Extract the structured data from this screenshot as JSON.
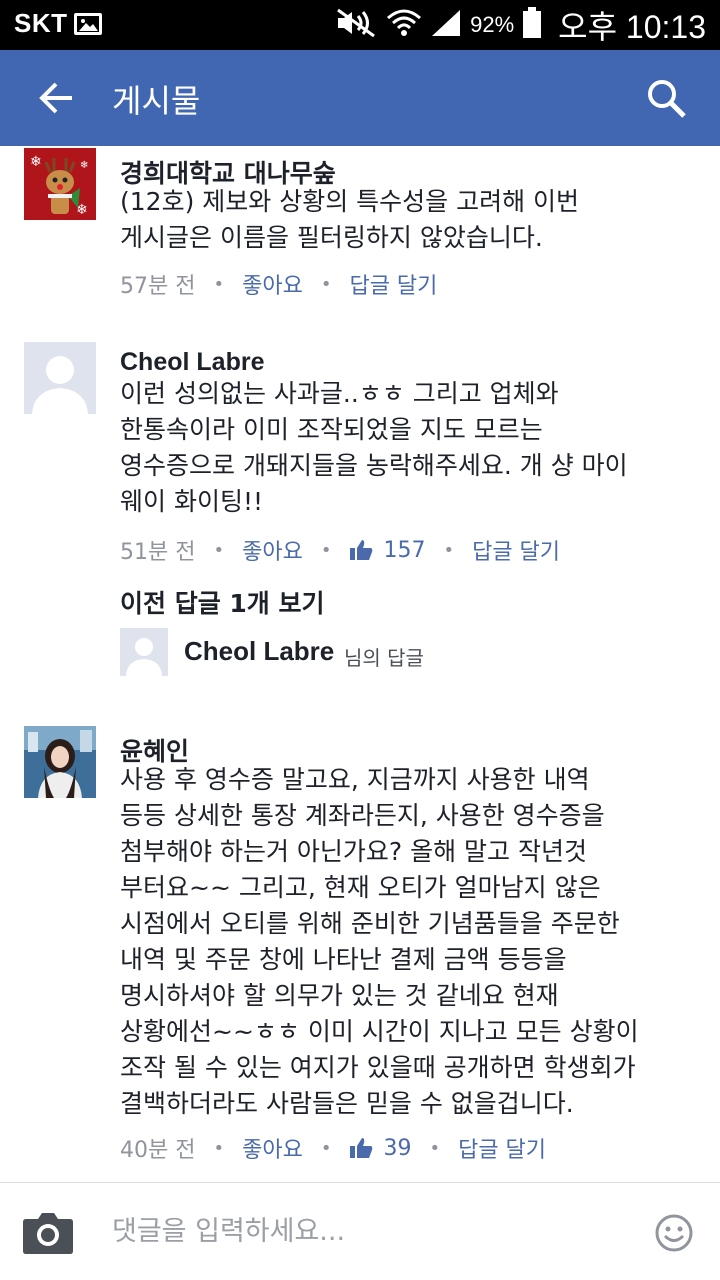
{
  "status_bar": {
    "carrier": "SKT",
    "battery": "92%",
    "time": "오후 10:13"
  },
  "app_bar": {
    "title": "게시물",
    "back_icon": "arrow-left-icon",
    "search_icon": "search-icon"
  },
  "comments": [
    {
      "author": "경희대학교 대나무숲",
      "avatar": "reindeer-avatar",
      "lines": [
        "(12호) 제보와 상황의 특수성을 고려해 이번",
        "게시글은 이름을 필터링하지 않았습니다."
      ],
      "time": "57분 전",
      "like_label": "좋아요",
      "reply_label": "답글 달기"
    },
    {
      "author": "Cheol Labre",
      "avatar": "default-profile-avatar",
      "lines": [
        "이런 성의없는 사과글..ㅎㅎ 그리고 업체와",
        "한통속이라 이미 조작되었을 지도 모르는",
        "영수증으로 개돼지들을 농락해주세요. 개 샹 마이",
        "웨이 화이팅!!"
      ],
      "time": "51분 전",
      "like_label": "좋아요",
      "likes": "157",
      "reply_label": "답글 달기",
      "previous_replies": "이전 답글 1개 보기",
      "reply_preview": {
        "name": "Cheol Labre",
        "suffix": "님의 답글"
      }
    },
    {
      "author": "윤혜인",
      "avatar": "user-photo-avatar",
      "lines": [
        "사용 후 영수증 말고요, 지금까지 사용한 내역",
        "등등 상세한 통장 계좌라든지, 사용한 영수증을",
        "첨부해야 하는거 아닌가요? 올해 말고 작년것",
        "부터요~~ 그리고, 현재 오티가 얼마남지 않은",
        "시점에서 오티를 위해 준비한 기념품들을 주문한",
        "내역 및 주문 창에 나타난 결제 금액 등등을",
        "명시하셔야 할 의무가 있는 것 같네요 현재",
        "상황에선~~ㅎㅎ 이미 시간이 지나고 모든 상황이",
        "조작 될 수 있는 여지가 있을때 공개하면 학생회가",
        "결백하더라도 사람들은 믿을 수 없을겁니다."
      ],
      "time": "40분 전",
      "like_label": "좋아요",
      "likes": "39",
      "reply_label": "답글 달기"
    }
  ],
  "composer": {
    "placeholder": "댓글을 입력하세요...",
    "camera_icon": "camera-icon",
    "emoji_icon": "smiley-icon"
  },
  "colors": {
    "app_bar": "#4267b2",
    "link": "#4b6aab",
    "meta_text": "#90949c"
  }
}
